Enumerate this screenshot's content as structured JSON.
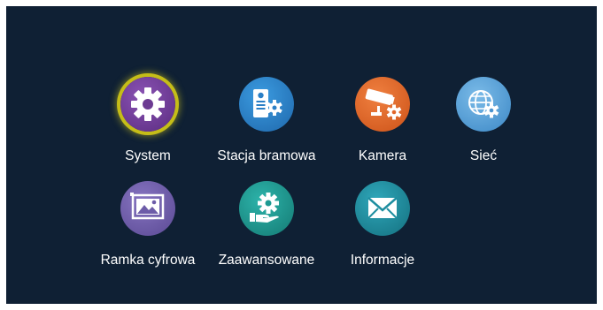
{
  "menu": {
    "items": [
      {
        "label": "System",
        "icon": "gear-icon",
        "color": "#6c3a92",
        "selected": true
      },
      {
        "label": "Stacja bramowa",
        "icon": "door-station-icon",
        "color": "#2a7fc6",
        "selected": false
      },
      {
        "label": "Kamera",
        "icon": "cctv-camera-icon",
        "color": "#e2672a",
        "selected": false
      },
      {
        "label": "Sieć",
        "icon": "network-globe-icon",
        "color": "#5aa3da",
        "selected": false
      },
      {
        "label": "Ramka cyfrowa",
        "icon": "photo-frame-icon",
        "color": "#6d5ca8",
        "selected": false
      },
      {
        "label": "Zaawansowane",
        "icon": "hand-gear-icon",
        "color": "#1c9a92",
        "selected": false
      },
      {
        "label": "Informacje",
        "icon": "envelope-icon",
        "color": "#1e8ea0",
        "selected": false
      }
    ]
  },
  "colors": {
    "background": "#0f2034",
    "selection_ring": "#c5bd18"
  }
}
